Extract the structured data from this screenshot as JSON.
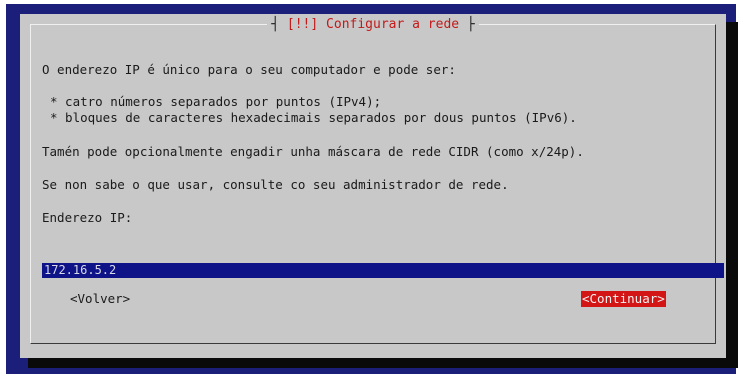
{
  "dialog": {
    "title": "[!!] Configurar a rede",
    "text": {
      "intro": "O enderezo IP é único para o seu computador e pode ser:",
      "bullet1": "* catro números separados por puntos (IPv4);",
      "bullet2": "* bloques de caracteres hexadecimais separados por dous puntos (IPv6).",
      "cidr": "Tamén pode opcionalmente engadir unha máscara de rede CIDR (como x/24p).",
      "admin": "Se non sabe o que usar, consulte co seu administrador de rede.",
      "field_label": "Enderezo IP:"
    },
    "ip_value": "172.16.5.2",
    "buttons": {
      "back": "<Volver>",
      "continue": "<Continuar>"
    }
  },
  "colors": {
    "background": "#1b1f7a",
    "dialog": "#c8c8c8",
    "title": "#c21a1a",
    "field": "#0e1487",
    "selected_button": "#d41515"
  }
}
